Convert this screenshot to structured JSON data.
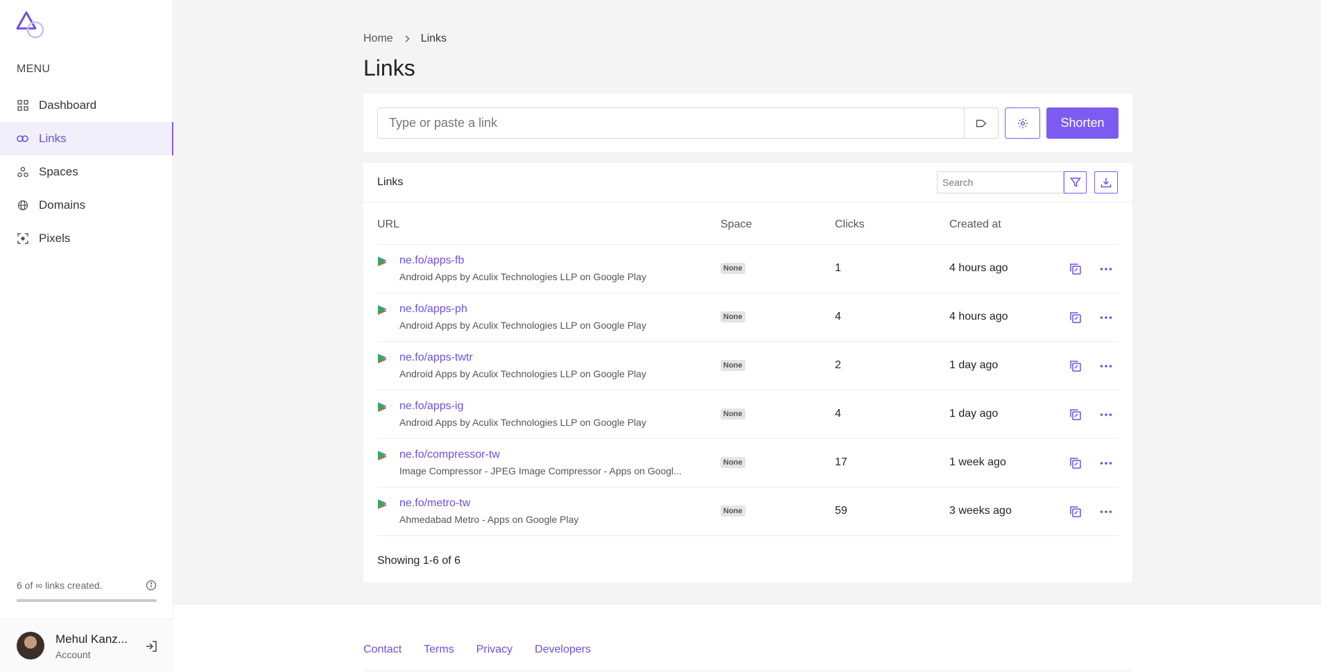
{
  "sidebar": {
    "menu_title": "MENU",
    "items": [
      {
        "label": "Dashboard",
        "icon": "grid-icon"
      },
      {
        "label": "Links",
        "icon": "link-icon"
      },
      {
        "label": "Spaces",
        "icon": "spaces-icon"
      },
      {
        "label": "Domains",
        "icon": "globe-icon"
      },
      {
        "label": "Pixels",
        "icon": "pixel-icon"
      }
    ],
    "active_item": "Links",
    "usage_text": "6 of ∞ links created.",
    "user": {
      "name": "Mehul Kanz...",
      "sub": "Account"
    }
  },
  "breadcrumb": {
    "home": "Home",
    "current": "Links"
  },
  "page_title": "Links",
  "shorten": {
    "placeholder": "Type or paste a link",
    "button_label": "Shorten"
  },
  "links_card": {
    "title": "Links",
    "search_placeholder": "Search",
    "columns": {
      "url": "URL",
      "space": "Space",
      "clicks": "Clicks",
      "created": "Created at"
    },
    "rows": [
      {
        "short": "ne.fo/apps-fb",
        "desc": "Android Apps by Aculix Technologies LLP on Google Play",
        "space": "None",
        "clicks": "1",
        "created": "4 hours ago"
      },
      {
        "short": "ne.fo/apps-ph",
        "desc": "Android Apps by Aculix Technologies LLP on Google Play",
        "space": "None",
        "clicks": "4",
        "created": "4 hours ago"
      },
      {
        "short": "ne.fo/apps-twtr",
        "desc": "Android Apps by Aculix Technologies LLP on Google Play",
        "space": "None",
        "clicks": "2",
        "created": "1 day ago"
      },
      {
        "short": "ne.fo/apps-ig",
        "desc": "Android Apps by Aculix Technologies LLP on Google Play",
        "space": "None",
        "clicks": "4",
        "created": "1 day ago"
      },
      {
        "short": "ne.fo/compressor-tw",
        "desc": "Image Compressor - JPEG Image Compressor - Apps on Googl...",
        "space": "None",
        "clicks": "17",
        "created": "1 week ago"
      },
      {
        "short": "ne.fo/metro-tw",
        "desc": "Ahmedabad Metro - Apps on Google Play",
        "space": "None",
        "clicks": "59",
        "created": "3 weeks ago"
      }
    ],
    "showing": "Showing 1-6 of 6"
  },
  "footer": {
    "links": [
      "Contact",
      "Terms",
      "Privacy",
      "Developers"
    ]
  },
  "colors": {
    "accent": "#7c5cf0",
    "background": "#f4f4f4"
  }
}
